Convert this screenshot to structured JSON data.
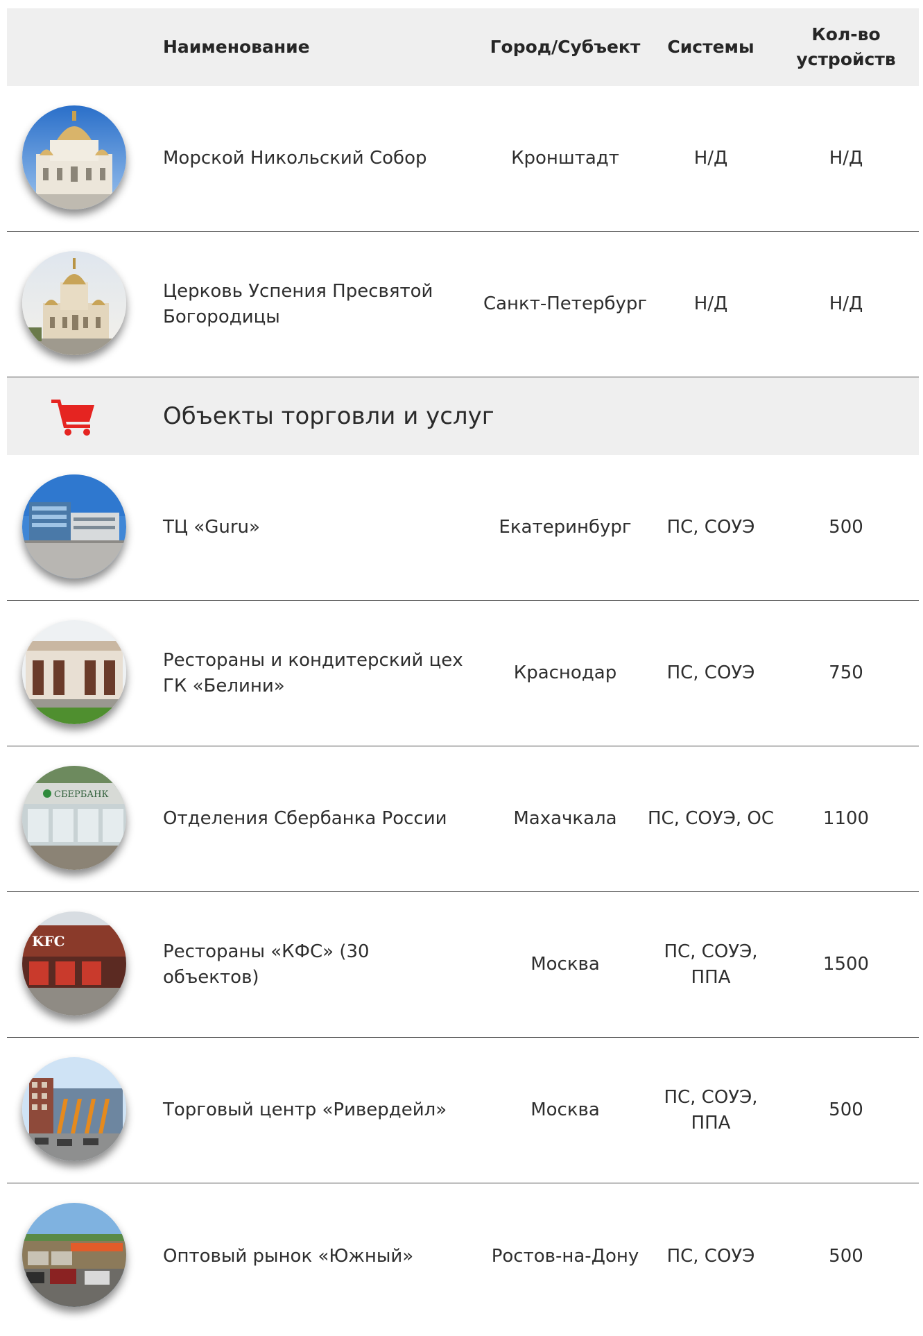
{
  "header": {
    "name": "Наименование",
    "city": "Город/Субъект",
    "systems": "Системы",
    "count_line1": "Кол-во",
    "count_line2": "устройств"
  },
  "rows_top": [
    {
      "name": "Морской Никольский Собор",
      "city": "Кронштадт",
      "systems": "Н/Д",
      "count": "Н/Д",
      "photo": "cathedral-photo"
    },
    {
      "name": "Церковь Успения Пресвятой Богородицы",
      "city": "Санкт-Петербург",
      "systems": "Н/Д",
      "count": "Н/Д",
      "photo": "church-photo"
    }
  ],
  "section": {
    "title": "Объекты торговли и услуг",
    "icon": "shopping-cart-icon",
    "icon_color": "#e52421"
  },
  "rows_trade": [
    {
      "name": "ТЦ «Guru»",
      "city": "Екатеринбург",
      "systems": "ПС, СОУЭ",
      "count": "500",
      "photo": "mall-photo"
    },
    {
      "name": "Рестораны и кондитерский цех ГК «Белини»",
      "city": "Краснодар",
      "systems": "ПС, СОУЭ",
      "count": "750",
      "photo": "restaurant-photo"
    },
    {
      "name": "Отделения Сбербанка России",
      "city": "Махачкала",
      "systems": "ПС, СОУЭ, ОС",
      "count": "1100",
      "photo": "bank-photo"
    },
    {
      "name": "Рестораны «КФС» (30 объектов)",
      "city": "Москва",
      "systems": "ПС, СОУЭ, ППА",
      "count": "1500",
      "photo": "kfc-photo"
    },
    {
      "name": "Торговый центр «Ривердейл»",
      "city": "Москва",
      "systems": "ПС, СОУЭ, ППА",
      "count": "500",
      "photo": "riverdale-photo"
    },
    {
      "name": "Оптовый рынок «Южный»",
      "city": "Ростов-на-Дону",
      "systems": "ПС, СОУЭ",
      "count": "500",
      "photo": "market-photo"
    }
  ],
  "photo_text": {
    "bank_sign": "СБЕРБАНК",
    "kfc_sign": "KFC"
  }
}
